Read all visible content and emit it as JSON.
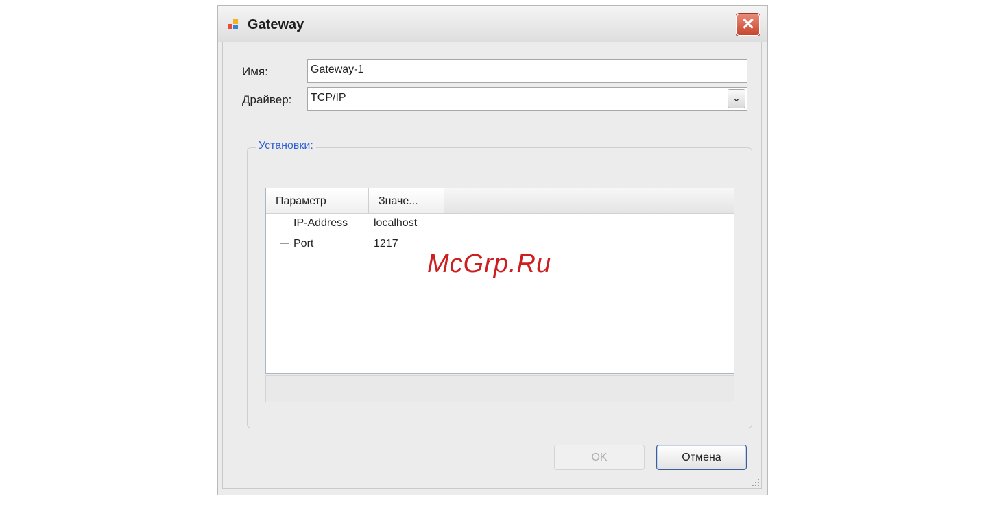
{
  "window": {
    "title": "Gateway",
    "close_glyph": "✕"
  },
  "form": {
    "name_label": "Имя:",
    "name_value": "Gateway-1",
    "driver_label": "Драйвер:",
    "driver_value": "TCP/IP",
    "dropdown_glyph": "⌄"
  },
  "settings": {
    "group_title": "Установки:",
    "columns": [
      "Параметр",
      "Значе..."
    ],
    "rows": [
      {
        "name": "IP-Address",
        "value": "localhost"
      },
      {
        "name": "Port",
        "value": "1217"
      }
    ]
  },
  "buttons": {
    "ok_label": "OK",
    "cancel_label": "Отмена"
  },
  "watermark": "McGrp.Ru",
  "icons": {
    "app": "app-icon",
    "close": "close-icon",
    "dropdown": "chevron-down-icon",
    "grip": "resize-grip-icon"
  },
  "colors": {
    "close_button": "#c8452d",
    "group_title": "#2f5fd6",
    "watermark": "#cc1f1f"
  }
}
